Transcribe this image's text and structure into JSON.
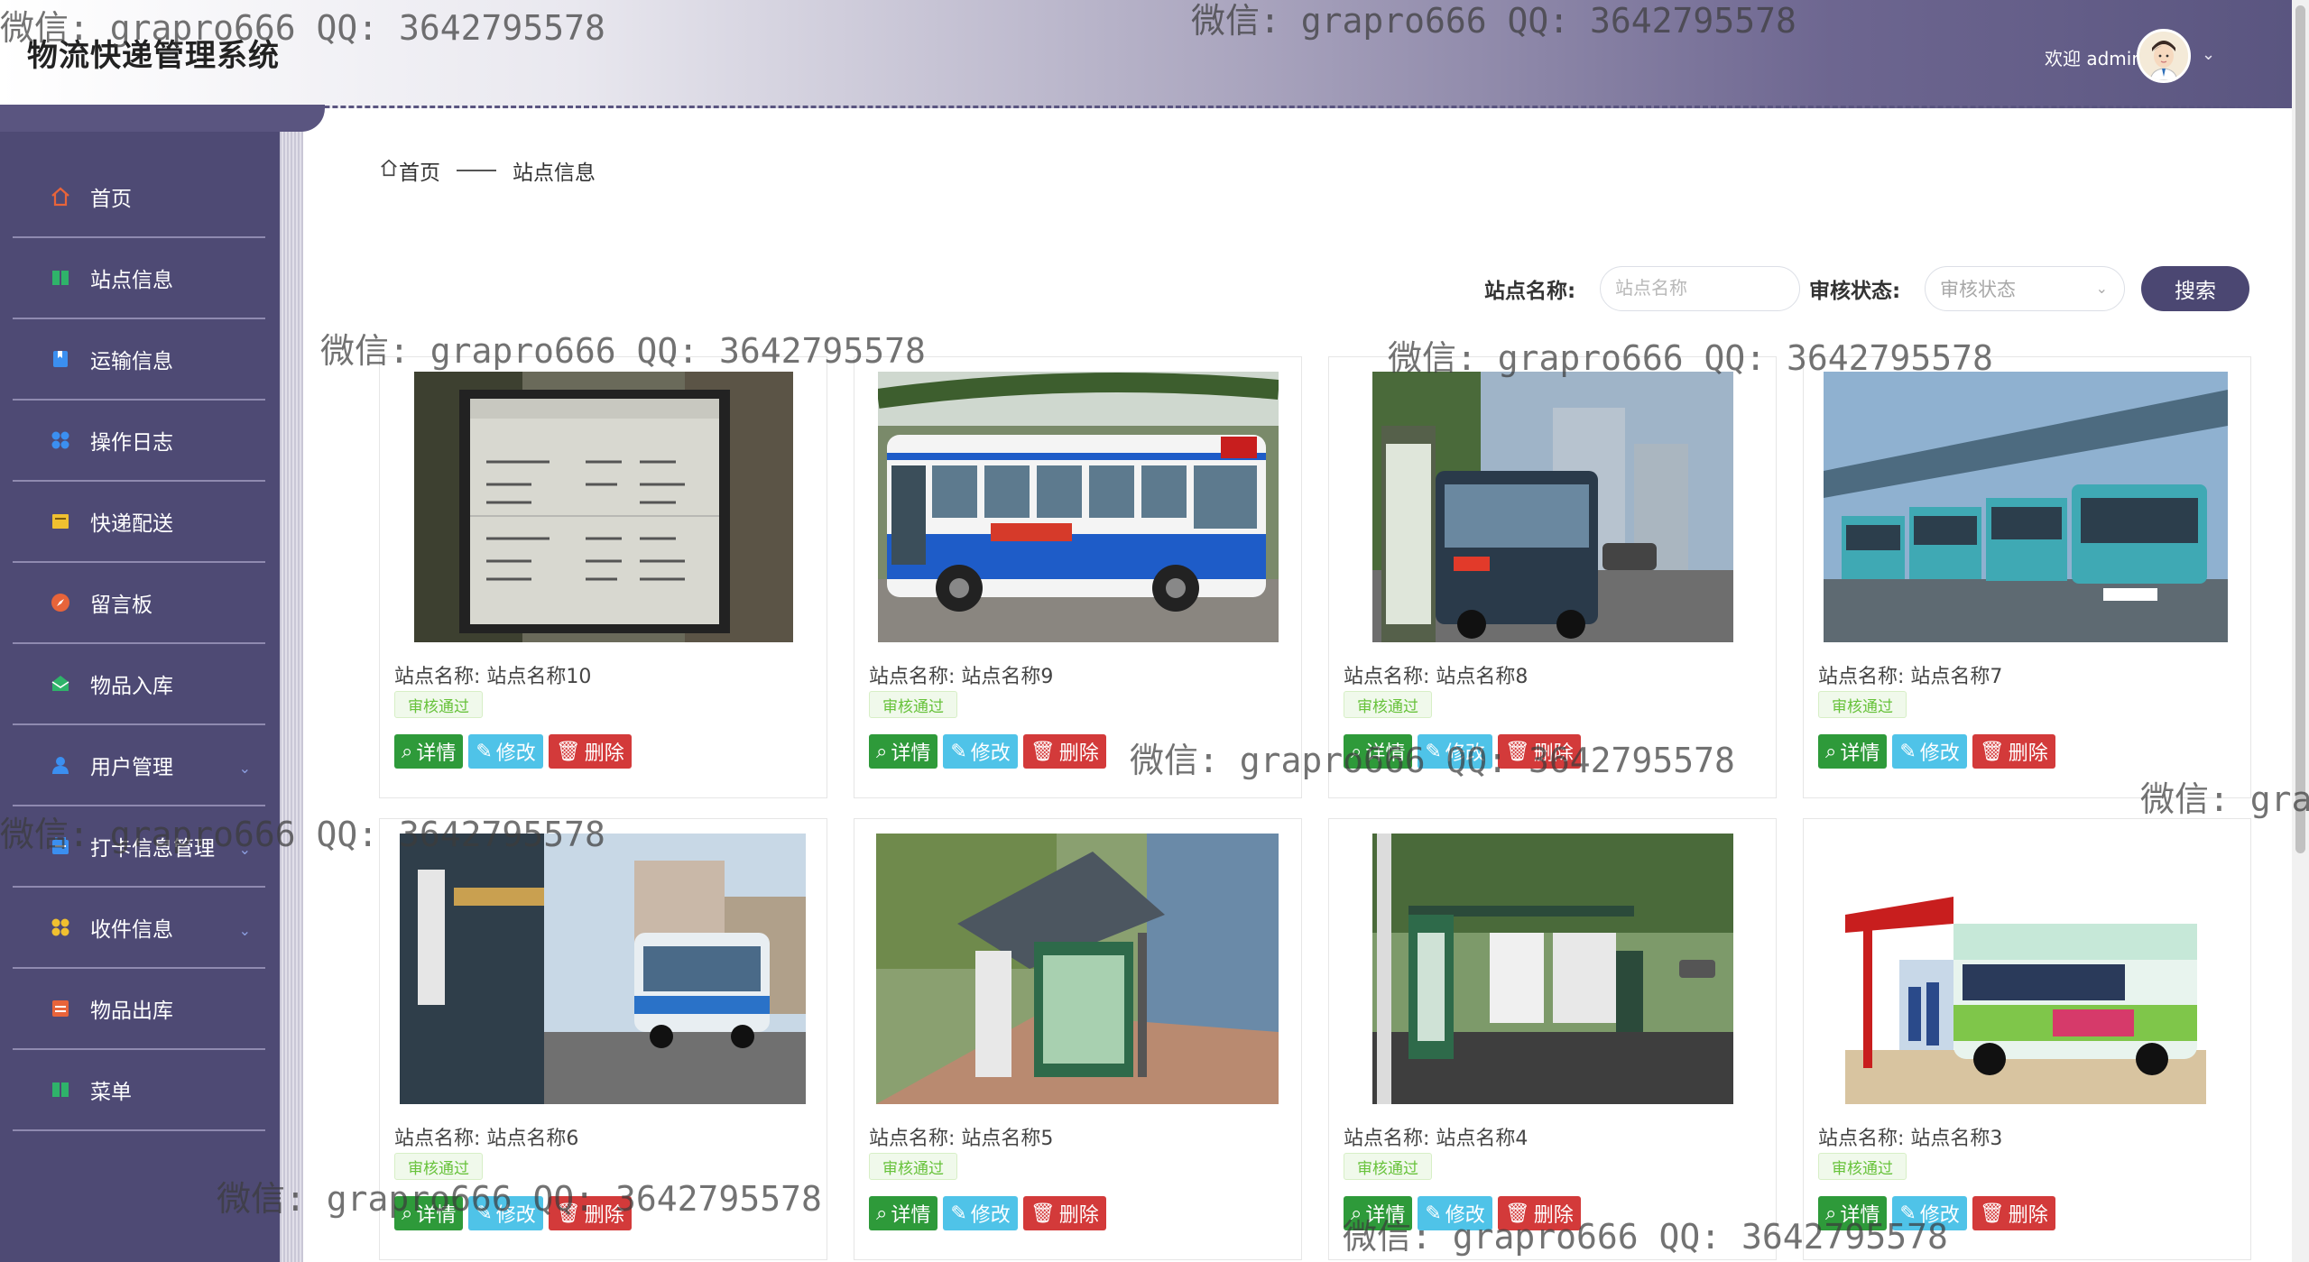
{
  "app": {
    "title": "物流快递管理系统"
  },
  "header": {
    "welcome": "欢迎 admin"
  },
  "sidebar": {
    "items": [
      {
        "label": "首页",
        "icon": "home-icon",
        "color": "#e8643a"
      },
      {
        "label": "站点信息",
        "icon": "book-icon",
        "color": "#2fb36a"
      },
      {
        "label": "运输信息",
        "icon": "bookmark-icon",
        "color": "#3b8ff0"
      },
      {
        "label": "操作日志",
        "icon": "grid-icon",
        "color": "#3b8ff0"
      },
      {
        "label": "快递配送",
        "icon": "folder-icon",
        "color": "#f0c030"
      },
      {
        "label": "留言板",
        "icon": "compass-icon",
        "color": "#e8643a"
      },
      {
        "label": "物品入库",
        "icon": "mail-icon",
        "color": "#2fb36a"
      },
      {
        "label": "用户管理",
        "icon": "user-icon",
        "color": "#3b8ff0"
      },
      {
        "label": "打卡信息管理",
        "icon": "calendar-icon",
        "color": "#3b8ff0"
      },
      {
        "label": "收件信息",
        "icon": "grid-icon",
        "color": "#f0c030"
      },
      {
        "label": "物品出库",
        "icon": "box-icon",
        "color": "#e8643a"
      },
      {
        "label": "菜单",
        "icon": "book-icon",
        "color": "#2fb36a"
      }
    ]
  },
  "breadcrumb": {
    "home": "首页",
    "current": "站点信息"
  },
  "search": {
    "name_label": "站点名称:",
    "name_placeholder": "站点名称",
    "status_label": "审核状态:",
    "status_placeholder": "审核状态",
    "button": "搜索"
  },
  "cards": [
    {
      "name": "站点名称: 站点名称10",
      "status": "审核通过"
    },
    {
      "name": "站点名称: 站点名称9",
      "status": "审核通过"
    },
    {
      "name": "站点名称: 站点名称8",
      "status": "审核通过"
    },
    {
      "name": "站点名称: 站点名称7",
      "status": "审核通过"
    },
    {
      "name": "站点名称: 站点名称6",
      "status": "审核通过"
    },
    {
      "name": "站点名称: 站点名称5",
      "status": "审核通过"
    },
    {
      "name": "站点名称: 站点名称4",
      "status": "审核通过"
    },
    {
      "name": "站点名称: 站点名称3",
      "status": "审核通过"
    }
  ],
  "actions": {
    "detail": "详情",
    "edit": "修改",
    "delete": "删除"
  },
  "watermark": "微信: grapro666 QQ: 3642795578"
}
